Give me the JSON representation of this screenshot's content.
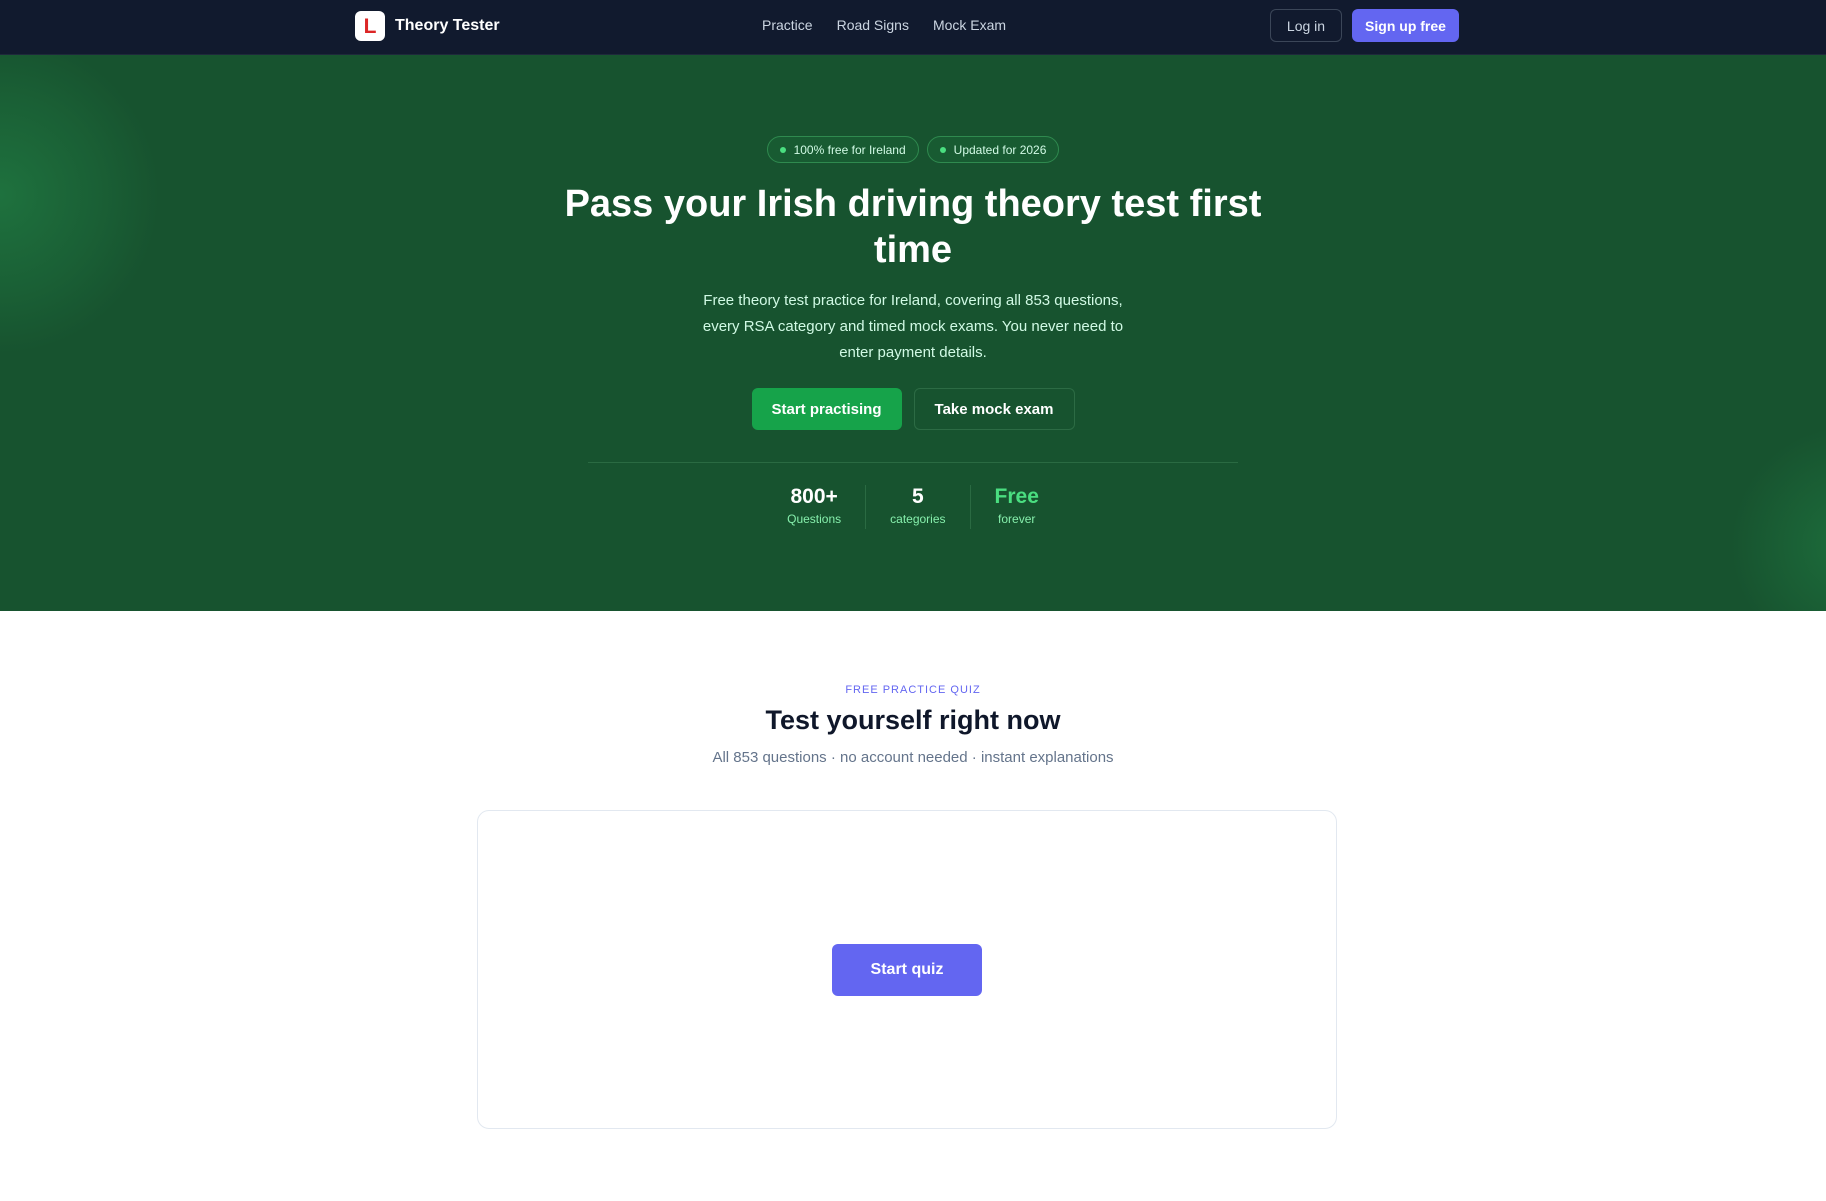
{
  "nav": {
    "brand_letter": "L",
    "brand_name": "Theory Tester",
    "links": [
      "Practice",
      "Road Signs",
      "Mock Exam"
    ],
    "login_label": "Log in",
    "signup_label": "Sign up free"
  },
  "hero": {
    "badges": [
      "100% free for Ireland",
      "Updated for 2026"
    ],
    "title": "Pass your Irish driving theory test first time",
    "subtitle": "Free theory test practice for Ireland, covering all 853 questions, every RSA category and timed mock exams. You never need to enter payment details.",
    "primary_cta": "Start practising",
    "secondary_cta": "Take mock exam",
    "stats": [
      {
        "value": "800+",
        "label": "Questions"
      },
      {
        "value": "5",
        "label": "categories"
      },
      {
        "value": "Free",
        "label": "forever"
      }
    ]
  },
  "quiz": {
    "kicker": "FREE PRACTICE QUIZ",
    "title": "Test yourself right now",
    "subtitle": "All 853 questions · no account needed · instant explanations",
    "start_label": "Start quiz"
  },
  "colors": {
    "nav_bg": "#111a2e",
    "hero_bg": "#17532f",
    "accent": "#6366f1",
    "primary_green": "#16a34a",
    "logo_red": "#dc2626"
  }
}
